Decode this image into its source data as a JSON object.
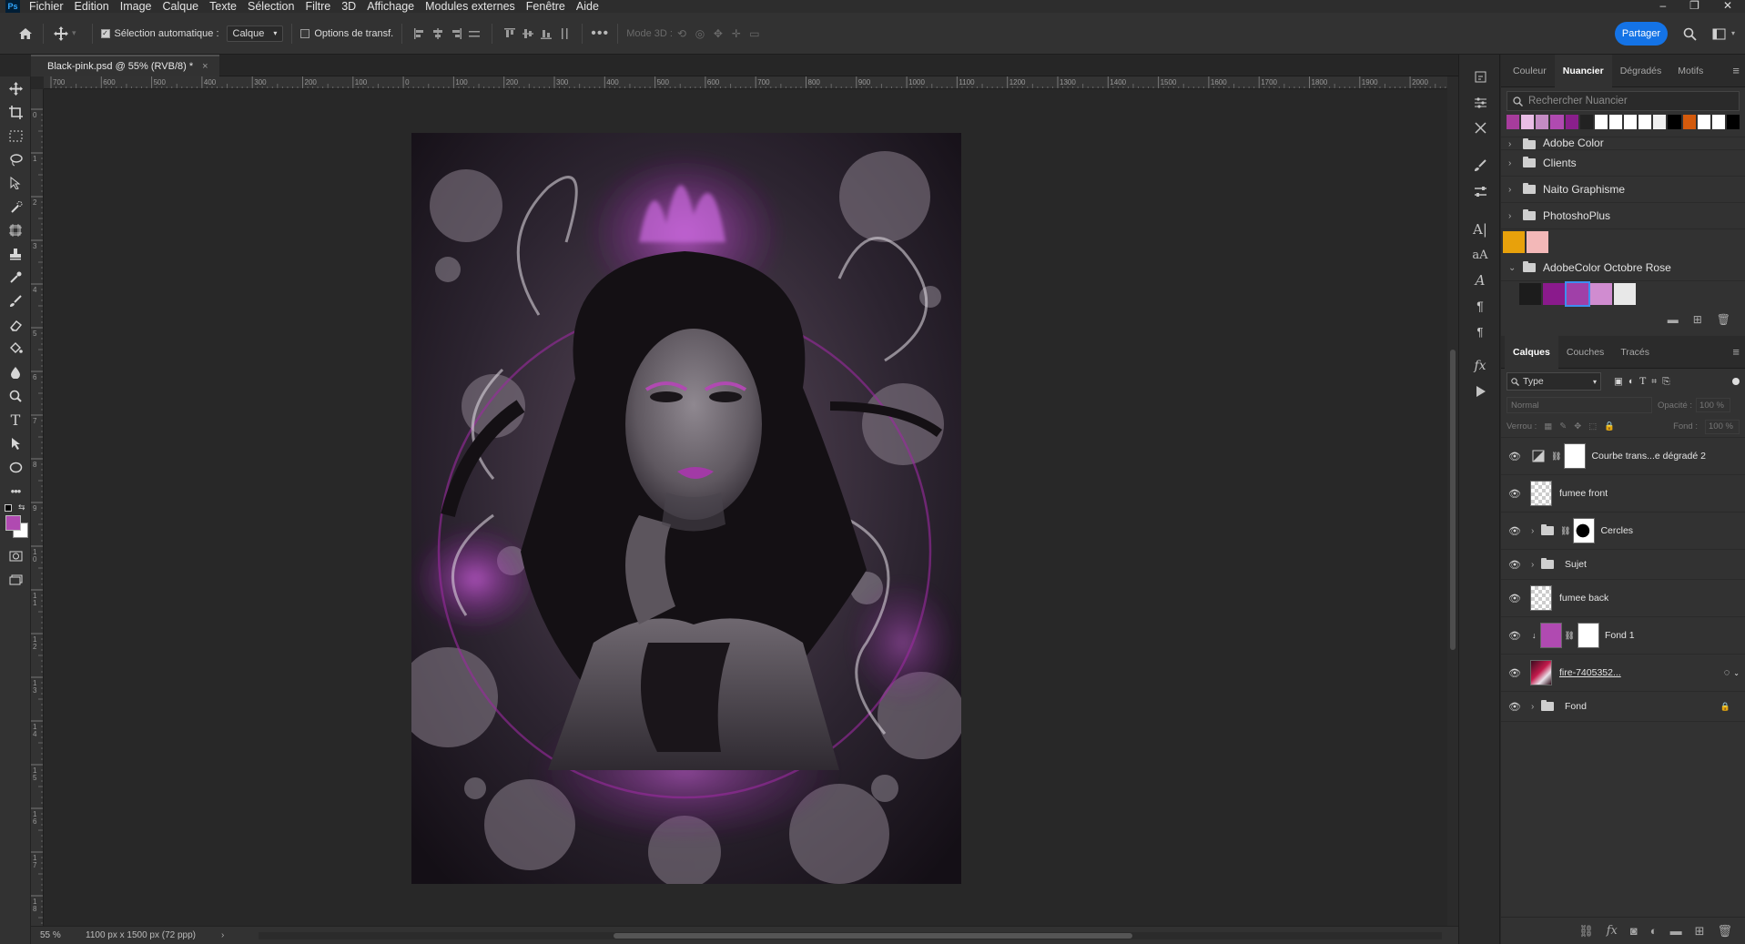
{
  "app": {
    "logo": "Ps"
  },
  "menu": [
    "Fichier",
    "Edition",
    "Image",
    "Calque",
    "Texte",
    "Sélection",
    "Filtre",
    "3D",
    "Affichage",
    "Modules externes",
    "Fenêtre",
    "Aide"
  ],
  "window_controls": {
    "minimize": "–",
    "restore": "❐",
    "close": "✕"
  },
  "options": {
    "auto_select_label": "Sélection automatique :",
    "auto_select_value": "Calque",
    "transform_label": "Options de transf.",
    "mode3d_label": "Mode 3D :",
    "share_label": "Partager"
  },
  "document": {
    "tab_title": "Black-pink.psd @ 55% (RVB/8) *",
    "tab_close": "×"
  },
  "ruler": {
    "top": [
      "700",
      "600",
      "500",
      "400",
      "300",
      "200",
      "100",
      "0",
      "100",
      "200",
      "300",
      "400",
      "500",
      "600",
      "700",
      "800",
      "900",
      "1000",
      "1100",
      "1200",
      "1300",
      "1400",
      "1500",
      "1600",
      "1700",
      "1800",
      "1900",
      "2000"
    ],
    "left": [
      "0",
      "1",
      "2",
      "3",
      "4",
      "5",
      "6",
      "7",
      "8",
      "9",
      "10",
      "11",
      "12",
      "13",
      "14",
      "15",
      "16",
      "17",
      "18"
    ]
  },
  "status": {
    "zoom": "55 %",
    "doc_info": "1100 px x 1500 px (72 ppp)",
    "arrow": "›"
  },
  "swatches_panel": {
    "tabs": [
      "Couleur",
      "Nuancier",
      "Dégradés",
      "Motifs"
    ],
    "active_tab": "Nuancier",
    "search_placeholder": "Rechercher Nuancier",
    "recent_colors": [
      "#a73c9c",
      "#e9bde6",
      "#c48cc4",
      "#b04ab1",
      "#8a1f8c",
      "#222222",
      "#ffffff",
      "#ffffff",
      "#ffffff",
      "#ffffff",
      "#f0f0f0",
      "#000000",
      "#d45a0c",
      "#ffffff",
      "#ffffff",
      "#000000"
    ],
    "groups": [
      {
        "name": "Adobe Color",
        "expanded": false
      },
      {
        "name": "Clients",
        "expanded": false
      },
      {
        "name": "Naito Graphisme",
        "expanded": false
      },
      {
        "name": "PhotoshoPlus",
        "expanded": false
      }
    ],
    "loose_swatches": [
      "#e8a10b",
      "#f3b8b8"
    ],
    "open_group": {
      "name": "AdobeColor Octobre Rose",
      "colors": [
        "#1c1c1c",
        "#8a1a8c",
        "#a040a8",
        "#d08cd0",
        "#e8e8e8"
      ]
    }
  },
  "layers_panel": {
    "tabs": [
      "Calques",
      "Couches",
      "Tracés"
    ],
    "active_tab": "Calques",
    "filter": "Type",
    "blend_mode": "Normal",
    "opacity_label": "Opacité :",
    "opacity_value": "100 %",
    "lock_label": "Verrou :",
    "fill_label": "Fond :",
    "fill_value": "100 %",
    "layers": [
      {
        "name": "Courbe trans...e dégradé 2",
        "kind": "adjustment"
      },
      {
        "name": "fumee front",
        "kind": "pixel"
      },
      {
        "name": "Cercles",
        "kind": "group-mask"
      },
      {
        "name": "Sujet",
        "kind": "group"
      },
      {
        "name": "fumee back",
        "kind": "pixel"
      },
      {
        "name": "Fond 1",
        "kind": "fill-clipped"
      },
      {
        "name": "fire-7405352...",
        "kind": "smart"
      },
      {
        "name": "Fond",
        "kind": "group-locked"
      }
    ]
  },
  "colors": {
    "foreground": "#b04ab1",
    "background": "#ffffff",
    "share": "#1473e6",
    "accent": "#9b2aa0"
  }
}
